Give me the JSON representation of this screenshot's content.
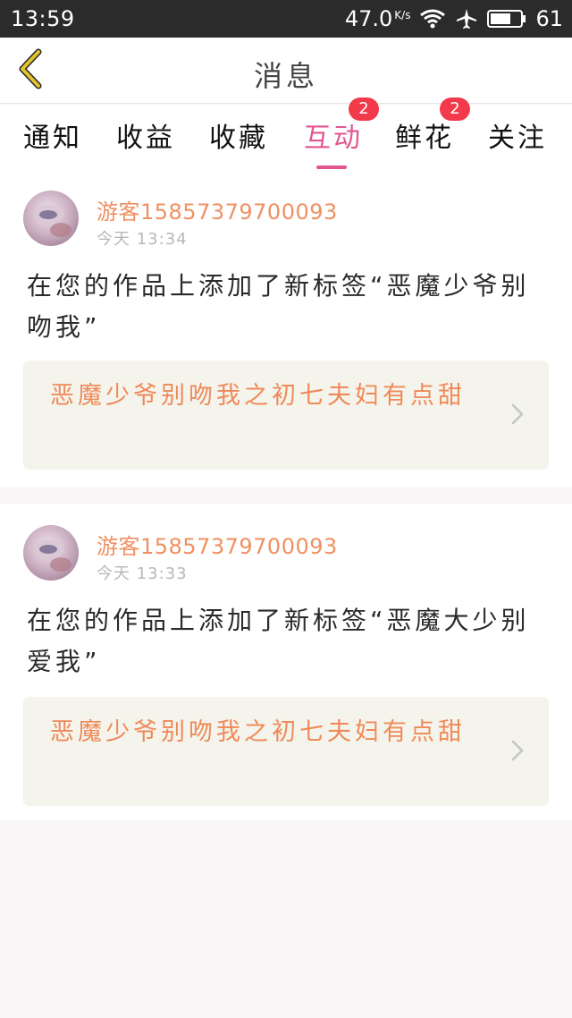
{
  "status_bar": {
    "time": "13:59",
    "speed": "47.0",
    "speed_unit": "K/s",
    "battery": "61",
    "icons": [
      "wifi-icon",
      "airplane-icon",
      "battery-icon"
    ]
  },
  "header": {
    "title": "消息",
    "back_icon": "chevron-left-icon"
  },
  "tabs": [
    {
      "label": "通知",
      "active": false,
      "badge": null
    },
    {
      "label": "收益",
      "active": false,
      "badge": null
    },
    {
      "label": "收藏",
      "active": false,
      "badge": null
    },
    {
      "label": "互动",
      "active": true,
      "badge": "2"
    },
    {
      "label": "鲜花",
      "active": false,
      "badge": "2"
    },
    {
      "label": "关注",
      "active": false,
      "badge": null
    }
  ],
  "messages": [
    {
      "username": "游客15857379700093",
      "time": "今天 13:34",
      "text": "在您的作品上添加了新标签“恶魔少爷别吻我”",
      "work_title": "恶魔少爷别吻我之初七夫妇有点甜"
    },
    {
      "username": "游客15857379700093",
      "time": "今天 13:33",
      "text": "在您的作品上添加了新标签“恶魔大少别爱我”",
      "work_title": "恶魔少爷别吻我之初七夫妇有点甜"
    }
  ],
  "colors": {
    "accent": "#e35590",
    "username": "#ef9062",
    "work_title": "#ef8a58",
    "badge": "#f23a4a",
    "status_bar": "#2b2b2b",
    "back_icon": "#e2c22e"
  }
}
